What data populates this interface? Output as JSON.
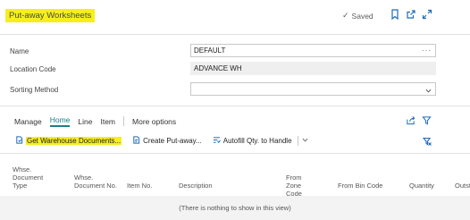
{
  "header": {
    "title": "Put-away Worksheets",
    "saved_label": "Saved"
  },
  "fields": [
    {
      "label": "Name",
      "value": "DEFAULT",
      "kind": "lookup"
    },
    {
      "label": "Location Code",
      "value": "ADVANCE WH",
      "kind": "readonly"
    },
    {
      "label": "Sorting Method",
      "value": "",
      "kind": "dropdown"
    }
  ],
  "menu": {
    "items": [
      "Manage",
      "Home",
      "Line",
      "Item"
    ],
    "active": "Home",
    "more": "More options"
  },
  "actions": {
    "get_warehouse_documents": "Get Warehouse Documents...",
    "create_put_away": "Create Put-away...",
    "autofill": "Autofill Qty. to Handle"
  },
  "table": {
    "headers": {
      "doc_type": "Whse. Document Type",
      "doc_no": "Whse. Document No.",
      "item_no": "Item No.",
      "description": "Description",
      "from_zone": "From Zone Code",
      "from_bin": "From Bin Code",
      "quantity": "Quantity",
      "outstanding": "Outst"
    },
    "empty_message": "(There is nothing to show in this view)"
  },
  "colors": {
    "highlight": "#f6ef1c",
    "accent": "#1a7f86",
    "icon": "#1f6bb8"
  }
}
